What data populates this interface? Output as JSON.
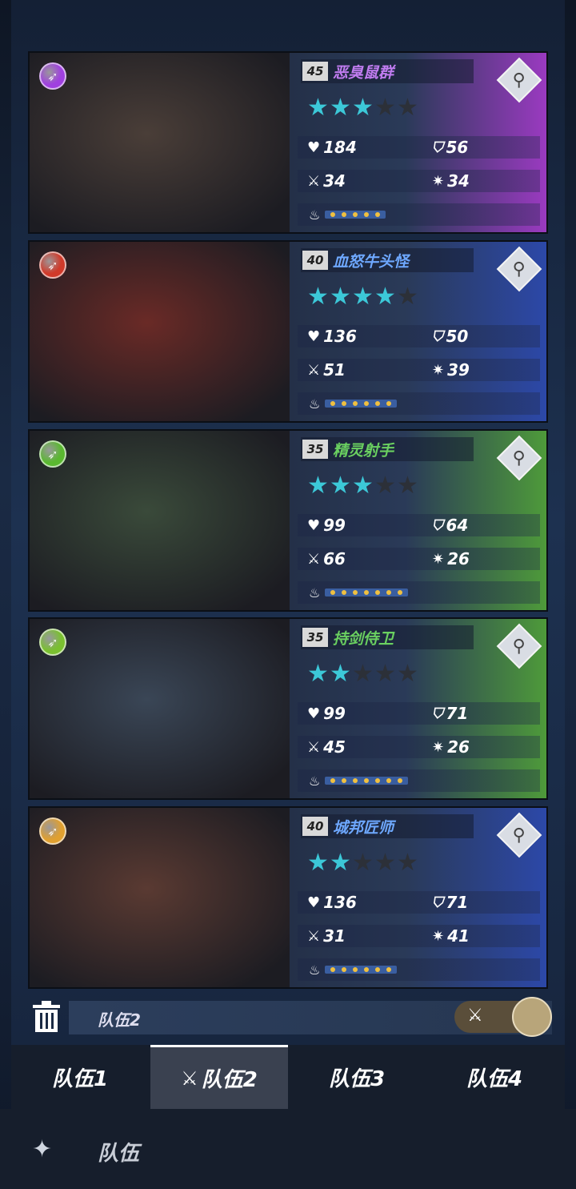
{
  "cards": [
    {
      "level": "45",
      "name": "恶臭鼠群",
      "name_color": "#c07cf0",
      "element_icon": "arrow-element-icon",
      "element_color": "#a040e0",
      "stars_on": 3,
      "stars_total": 5,
      "hp": "184",
      "def": "56",
      "atk": "34",
      "spd": "34",
      "energy_dots": 5,
      "panel_color": "#9a3ac0",
      "portrait_color": "#4a3e38"
    },
    {
      "level": "40",
      "name": "血怒牛头怪",
      "name_color": "#6ea8ff",
      "element_icon": "fire-element-icon",
      "element_color": "#d03a2a",
      "stars_on": 4,
      "stars_total": 5,
      "hp": "136",
      "def": "50",
      "atk": "51",
      "spd": "39",
      "energy_dots": 6,
      "panel_color": "#2c48a8",
      "portrait_color": "#6a2a26"
    },
    {
      "level": "35",
      "name": "精灵射手",
      "name_color": "#6ad060",
      "element_icon": "leaf-element-icon",
      "element_color": "#5ab830",
      "stars_on": 3,
      "stars_total": 5,
      "hp": "99",
      "def": "64",
      "atk": "66",
      "spd": "26",
      "energy_dots": 7,
      "panel_color": "#4e9a3a",
      "portrait_color": "#3a4a3a"
    },
    {
      "level": "35",
      "name": "持剑侍卫",
      "name_color": "#6ad060",
      "element_icon": "leaf-element-icon",
      "element_color": "#7ac030",
      "stars_on": 2,
      "stars_total": 5,
      "hp": "99",
      "def": "71",
      "atk": "45",
      "spd": "26",
      "energy_dots": 7,
      "panel_color": "#4e9a3a",
      "portrait_color": "#3a4656"
    },
    {
      "level": "40",
      "name": "城邦匠师",
      "name_color": "#6ea8ff",
      "element_icon": "fire-element-icon",
      "element_color": "#e0a030",
      "stars_on": 2,
      "stars_total": 5,
      "hp": "136",
      "def": "71",
      "atk": "31",
      "spd": "41",
      "energy_dots": 6,
      "panel_color": "#2c48a8",
      "portrait_color": "#5a3a32"
    }
  ],
  "team_name": "队伍2",
  "tabs": [
    {
      "label": "队伍1",
      "active": false
    },
    {
      "label": "队伍2",
      "active": true
    },
    {
      "label": "队伍3",
      "active": false
    },
    {
      "label": "队伍4",
      "active": false
    }
  ],
  "footer": {
    "label": "队伍"
  }
}
